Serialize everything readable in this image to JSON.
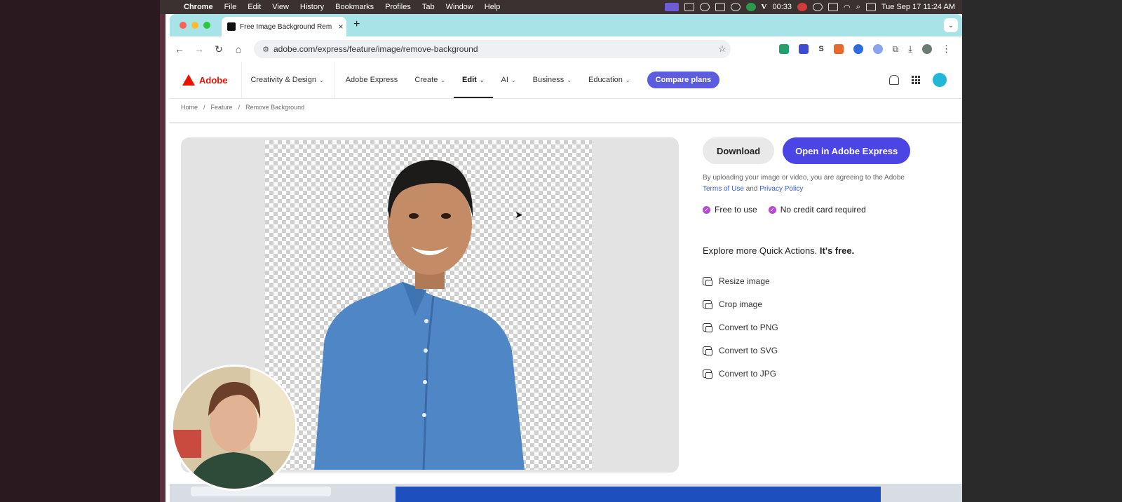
{
  "menubar": {
    "items": [
      "Chrome",
      "File",
      "Edit",
      "View",
      "History",
      "Bookmarks",
      "Profiles",
      "Tab",
      "Window",
      "Help"
    ],
    "timer": "00:33",
    "datetime": "Tue Sep 17  11:24 AM"
  },
  "browser": {
    "tab_title": "Free Image Background Rem",
    "url": "adobe.com/express/feature/image/remove-background"
  },
  "site_nav": {
    "logo_text": "Adobe",
    "items": [
      "Creativity & Design",
      "Adobe Express",
      "Create",
      "Edit",
      "AI",
      "Business",
      "Education"
    ],
    "cta": "Compare plans"
  },
  "breadcrumb": [
    "Home",
    "Feature",
    "Remove Background"
  ],
  "actions": {
    "download": "Download",
    "open": "Open in Adobe Express"
  },
  "terms": {
    "prefix": "By uploading your image or video, you are agreeing to the Adobe",
    "terms_link": "Terms of Use",
    "and": "and",
    "privacy_link": "Privacy Policy"
  },
  "badges": [
    "Free to use",
    "No credit card required"
  ],
  "explore": {
    "text": "Explore more Quick Actions.",
    "bold": "It's free."
  },
  "quick_actions": [
    "Resize image",
    "Crop image",
    "Convert to PNG",
    "Convert to SVG",
    "Convert to JPG"
  ],
  "colors": {
    "accent": "#4b45e6",
    "adobe_red": "#eb1000",
    "badge": "#b54bd3",
    "tab_strip": "#a7e3e7"
  }
}
